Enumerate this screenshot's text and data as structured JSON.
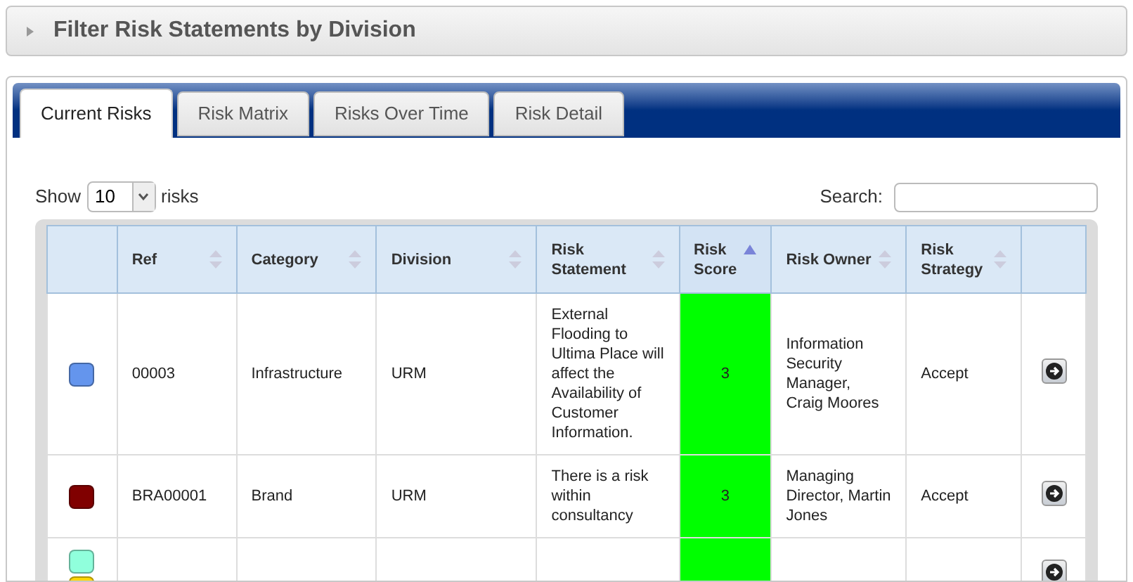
{
  "filter_panel": {
    "title": "Filter Risk Statements by Division",
    "expanded": false
  },
  "tabs": [
    {
      "label": "Current Risks",
      "selected": true
    },
    {
      "label": "Risk Matrix",
      "selected": false
    },
    {
      "label": "Risks Over Time",
      "selected": false
    },
    {
      "label": "Risk Detail",
      "selected": false
    }
  ],
  "length_control": {
    "label_before": "Show",
    "value": "10",
    "label_after": "risks"
  },
  "search": {
    "label": "Search:"
  },
  "table": {
    "columns": [
      {
        "sortable": false
      },
      {
        "label": "Ref",
        "sortable": true,
        "sorted": false
      },
      {
        "label": "Category",
        "sortable": true,
        "sorted": false
      },
      {
        "label": "Division",
        "sortable": true,
        "sorted": false
      },
      {
        "label": "Risk Statement",
        "sortable": true,
        "sorted": false
      },
      {
        "label": "Risk Score",
        "sortable": true,
        "sorted": true
      },
      {
        "label": "Risk Owner",
        "sortable": true,
        "sorted": false
      },
      {
        "label": "Risk Strategy",
        "sortable": true,
        "sorted": false
      },
      {
        "sortable": false
      }
    ],
    "rows": [
      {
        "markers": [
          {
            "color": "#6495ed"
          }
        ],
        "ref": "00003",
        "category": "Infrastructure",
        "division": "URM",
        "statement": "External Flooding to Ultima Place will affect the Availability of Customer Information.",
        "score": "3",
        "color": "#00ff00",
        "owner": "Information Security Manager, Craig Moores",
        "strategy": "Accept"
      },
      {
        "markers": [
          {
            "color": "#800000"
          }
        ],
        "ref": "BRA00001",
        "category": "Brand",
        "division": "URM",
        "statement": "There is a risk within consultancy",
        "score": "3",
        "color": "#00ff00",
        "owner": "Managing Director, Martin Jones",
        "strategy": "Accept"
      },
      {
        "markers": [
          {
            "color": "#90ffdc"
          },
          {
            "color": "#ffd700"
          }
        ],
        "color": "#00ff00"
      }
    ]
  }
}
